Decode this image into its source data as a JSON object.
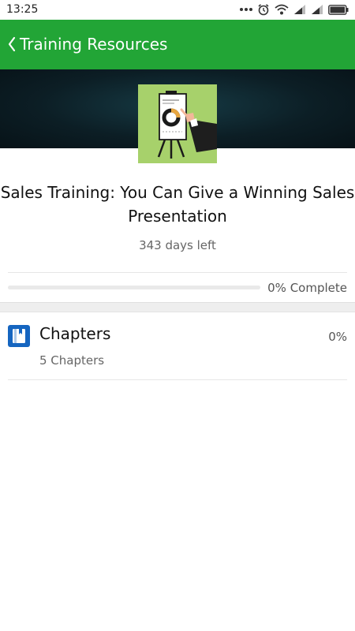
{
  "status_bar": {
    "time": "13:25"
  },
  "app_bar": {
    "title": "Training Resources",
    "color": "#22a536"
  },
  "course": {
    "title": "Sales Training: You Can Give a Winning Sales Presentation",
    "days_left": "343 days left",
    "progress_label": "0% Complete",
    "progress_fraction": 0
  },
  "chapters": {
    "title": "Chapters",
    "count": "5 Chapters",
    "percent": "0%",
    "icon_color": "#1565c0"
  },
  "icons": {
    "status": [
      "more-dots-icon",
      "alarm-icon",
      "wifi-icon",
      "signal-icon",
      "signal-icon",
      "battery-icon"
    ],
    "back": "chevron-left-icon",
    "chapters": "book-icon"
  }
}
